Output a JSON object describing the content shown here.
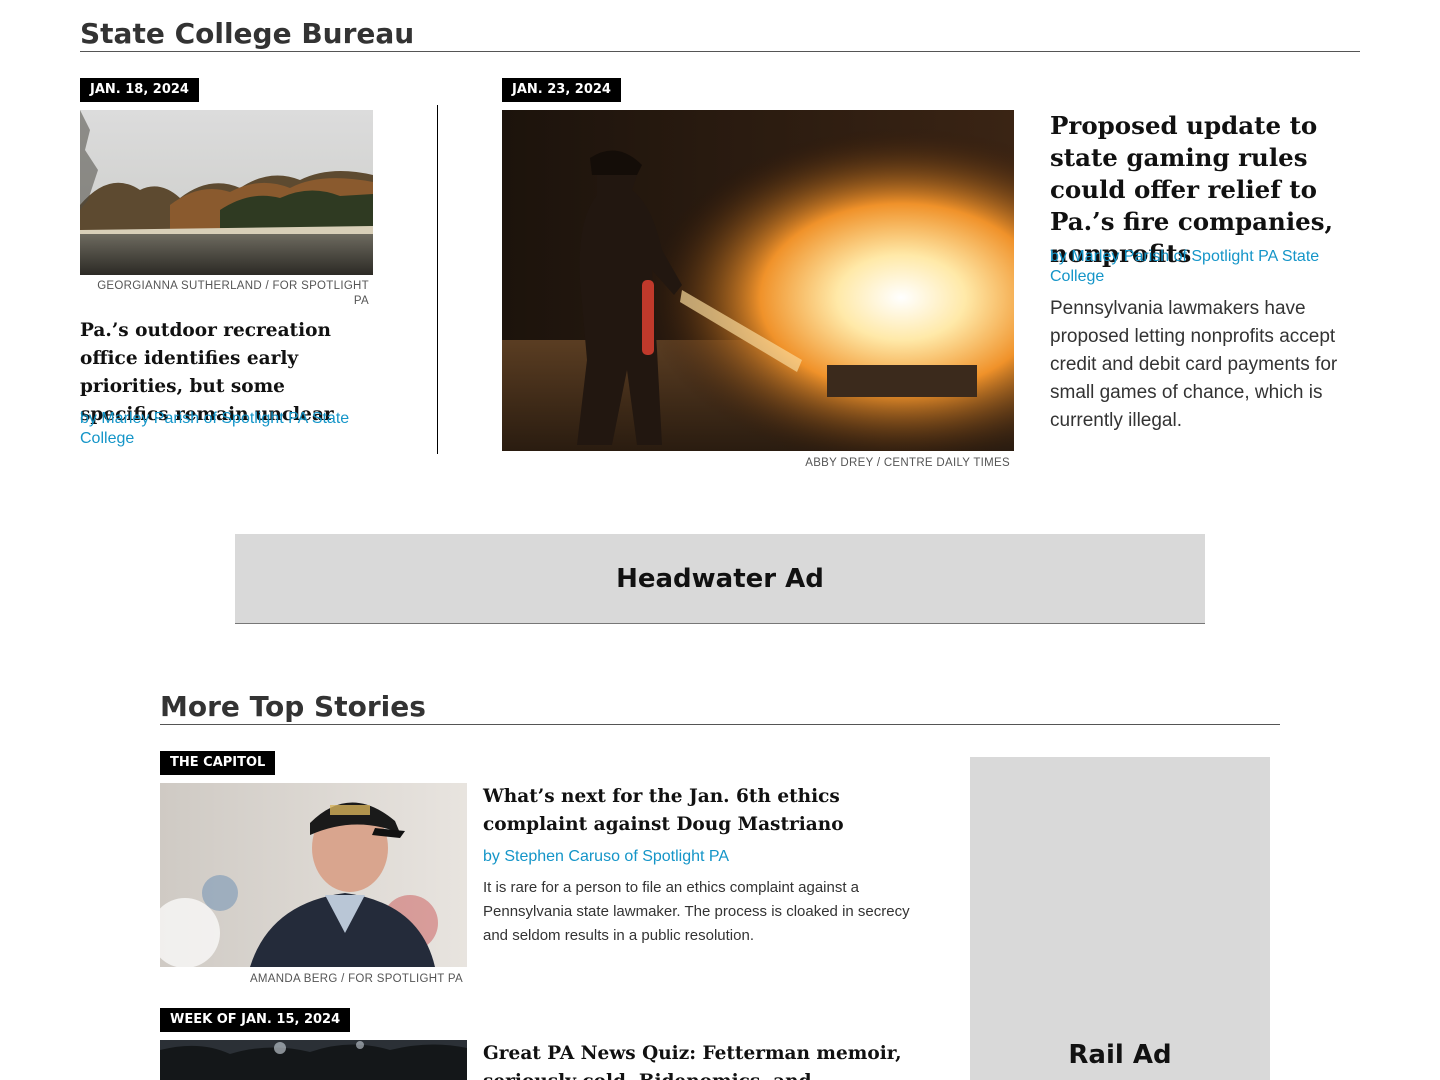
{
  "bureau": {
    "title": "State College Bureau",
    "story1": {
      "date": "JAN. 18, 2024",
      "photo_credit": "GEORGIANNA SUTHERLAND / FOR SPOTLIGHT PA",
      "headline": "Pa.’s outdoor recreation office identifies early priorities, but some specifics remain unclear",
      "byline": "by Marley Parish of Spotlight PA State College"
    },
    "story2": {
      "date": "JAN. 23, 2024",
      "photo_credit": "ABBY DREY / CENTRE DAILY TIMES",
      "headline": "Proposed update to state gaming rules could offer relief to Pa.’s fire companies, nonprofits",
      "byline": "by Marley Parish of Spotlight PA State College",
      "dek": "Pennsylvania lawmakers have proposed letting nonprofits accept credit and debit card payments for small games of chance, which is currently illegal."
    }
  },
  "ads": {
    "headwater": "Headwater Ad",
    "rail": "Rail Ad"
  },
  "more": {
    "title": "More Top Stories",
    "stories": [
      {
        "tag": "THE CAPITOL",
        "photo_credit": "AMANDA BERG / FOR SPOTLIGHT PA",
        "headline": "What’s next for the Jan. 6th ethics complaint against Doug Mastriano",
        "byline": "by Stephen Caruso of Spotlight PA",
        "dek": "It is rare for a person to file an ethics complaint against a Pennsylvania state lawmaker. The process is cloaked in secrecy and seldom results in a public resolution."
      },
      {
        "tag": "WEEK OF JAN. 15, 2024",
        "headline": "Great PA News Quiz: Fetterman memoir, seriously cold, Bidenomics, and underfunded schools"
      }
    ]
  }
}
